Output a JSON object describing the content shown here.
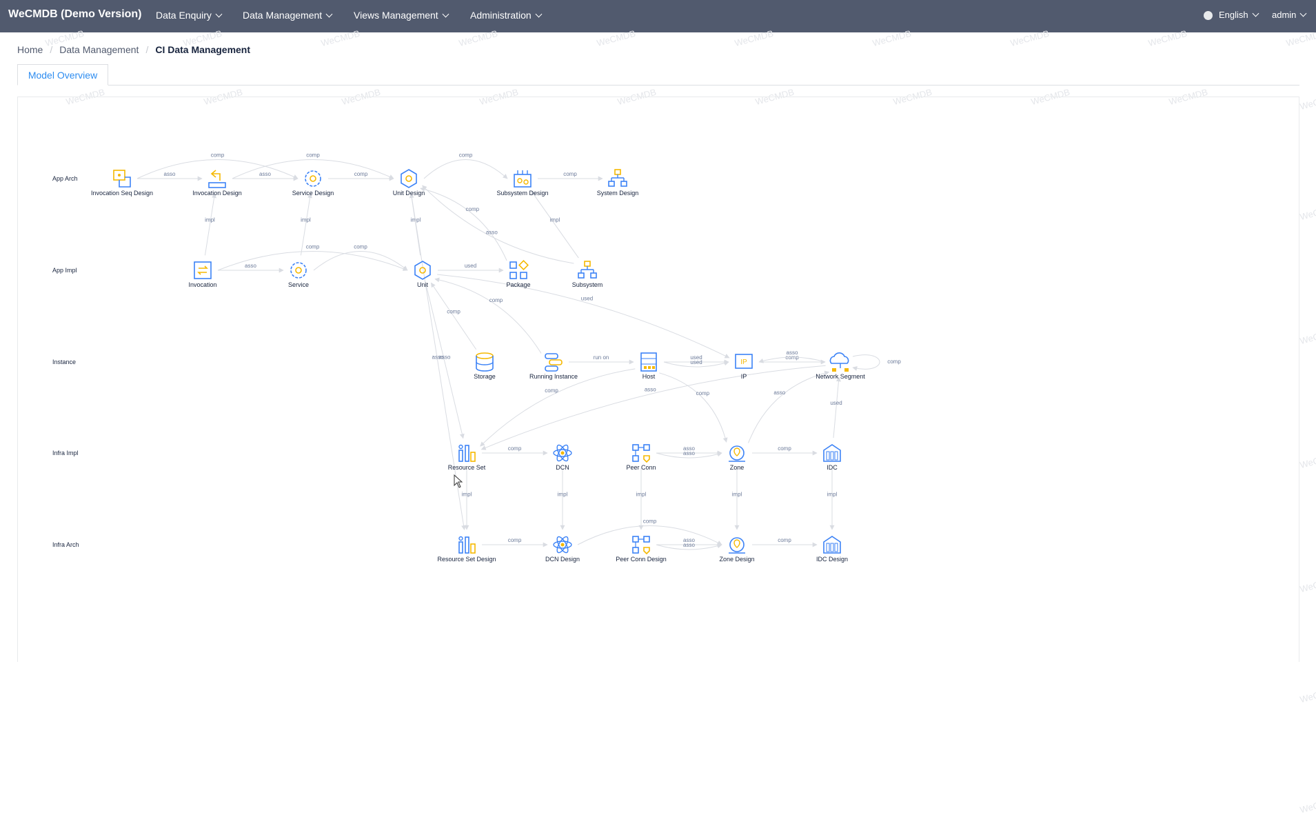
{
  "topbar": {
    "brand": "WeCMDB (Demo Version)",
    "menus": [
      "Data Enquiry",
      "Data Management",
      "Views Management",
      "Administration"
    ],
    "language": "English",
    "user": "admin"
  },
  "watermark": "WeCMDB",
  "breadcrumb": [
    "Home",
    "Data Management",
    "CI Data Management"
  ],
  "tabs": [
    "Model Overview"
  ],
  "graph": {
    "rows": [
      "App Arch",
      "App Impl",
      "Instance",
      "Infra Impl",
      "Infra Arch"
    ],
    "nodes": [
      {
        "id": "invseqd",
        "label": "Invocation Seq Design",
        "icon": "invocation-seq-design-icon"
      },
      {
        "id": "invd",
        "label": "Invocation Design",
        "icon": "invocation-design-icon"
      },
      {
        "id": "svcd",
        "label": "Service Design",
        "icon": "service-design-icon"
      },
      {
        "id": "unitd",
        "label": "Unit Design",
        "icon": "unit-design-icon"
      },
      {
        "id": "subd",
        "label": "Subsystem Design",
        "icon": "subsystem-design-icon"
      },
      {
        "id": "sysd",
        "label": "System Design",
        "icon": "system-design-icon"
      },
      {
        "id": "inv",
        "label": "Invocation",
        "icon": "invocation-icon"
      },
      {
        "id": "svc",
        "label": "Service",
        "icon": "service-icon"
      },
      {
        "id": "unit",
        "label": "Unit",
        "icon": "unit-icon"
      },
      {
        "id": "pkg",
        "label": "Package",
        "icon": "package-icon"
      },
      {
        "id": "sub",
        "label": "Subsystem",
        "icon": "subsystem-icon"
      },
      {
        "id": "stor",
        "label": "Storage",
        "icon": "storage-icon"
      },
      {
        "id": "run",
        "label": "Running Instance",
        "icon": "running-instance-icon"
      },
      {
        "id": "host",
        "label": "Host",
        "icon": "host-icon"
      },
      {
        "id": "ip",
        "label": "IP",
        "icon": "ip-icon"
      },
      {
        "id": "netseg",
        "label": "Network Segment",
        "icon": "network-segment-icon"
      },
      {
        "id": "rs",
        "label": "Resource Set",
        "icon": "resource-set-icon"
      },
      {
        "id": "dcn",
        "label": "DCN",
        "icon": "dcn-icon"
      },
      {
        "id": "peer",
        "label": "Peer Conn",
        "icon": "peer-conn-icon"
      },
      {
        "id": "zone",
        "label": "Zone",
        "icon": "zone-icon"
      },
      {
        "id": "idc",
        "label": "IDC",
        "icon": "idc-icon"
      },
      {
        "id": "rsd",
        "label": "Resource Set Design",
        "icon": "resource-set-design-icon"
      },
      {
        "id": "dcnd",
        "label": "DCN Design",
        "icon": "dcn-design-icon"
      },
      {
        "id": "peerd",
        "label": "Peer Conn Design",
        "icon": "peer-conn-design-icon"
      },
      {
        "id": "zoned",
        "label": "Zone Design",
        "icon": "zone-design-icon"
      },
      {
        "id": "idcd",
        "label": "IDC Design",
        "icon": "idc-design-icon"
      }
    ],
    "edges": [
      {
        "from": "invseqd",
        "to": "invd",
        "label": "asso"
      },
      {
        "from": "invd",
        "to": "svcd",
        "label": "asso"
      },
      {
        "from": "svcd",
        "to": "unitd",
        "label": "comp"
      },
      {
        "from": "unitd",
        "to": "subd",
        "label": "comp"
      },
      {
        "from": "subd",
        "to": "sysd",
        "label": "comp"
      },
      {
        "from": "invseqd",
        "to": "svcd",
        "label": "comp"
      },
      {
        "from": "invd",
        "to": "unitd",
        "label": "comp"
      },
      {
        "from": "inv",
        "to": "invd",
        "label": "impl"
      },
      {
        "from": "svc",
        "to": "svcd",
        "label": "impl"
      },
      {
        "from": "inv",
        "to": "unit",
        "label": "comp"
      },
      {
        "from": "unit",
        "to": "unitd",
        "label": "impl"
      },
      {
        "from": "pkg",
        "to": "unitd",
        "label": "comp"
      },
      {
        "from": "sub",
        "to": "unitd",
        "label": "asso"
      },
      {
        "from": "sub",
        "to": "subd",
        "label": "impl"
      },
      {
        "from": "inv",
        "to": "svc",
        "label": "asso"
      },
      {
        "from": "svc",
        "to": "unit",
        "label": "comp"
      },
      {
        "from": "unit",
        "to": "pkg",
        "label": "used"
      },
      {
        "from": "stor",
        "to": "unit",
        "label": "comp"
      },
      {
        "from": "unit",
        "to": "ip",
        "label": "used"
      },
      {
        "from": "run",
        "to": "unit",
        "label": "comp"
      },
      {
        "from": "run",
        "to": "host",
        "label": "run on"
      },
      {
        "from": "host",
        "to": "ip",
        "label": "used"
      },
      {
        "from": "host",
        "to": "ip",
        "label": "used"
      },
      {
        "from": "ip",
        "to": "netseg",
        "label": "comp"
      },
      {
        "from": "netseg",
        "to": "ip",
        "label": "asso"
      },
      {
        "from": "netseg",
        "to": "netseg",
        "label": "comp"
      },
      {
        "from": "unitd",
        "to": "rsd",
        "label": "asso"
      },
      {
        "from": "unit",
        "to": "rs",
        "label": "asso"
      },
      {
        "from": "rs",
        "to": "dcn",
        "label": "comp"
      },
      {
        "from": "host",
        "to": "rs",
        "label": "comp"
      },
      {
        "from": "host",
        "to": "zone",
        "label": "comp"
      },
      {
        "from": "netseg",
        "to": "rs",
        "label": "asso"
      },
      {
        "from": "zone",
        "to": "netseg",
        "label": "asso"
      },
      {
        "from": "idc",
        "to": "netseg",
        "label": "used"
      },
      {
        "from": "peer",
        "to": "zone",
        "label": "asso"
      },
      {
        "from": "peer",
        "to": "zone",
        "label": "asso"
      },
      {
        "from": "zone",
        "to": "idc",
        "label": "comp"
      },
      {
        "from": "rs",
        "to": "rsd",
        "label": "impl"
      },
      {
        "from": "dcn",
        "to": "dcnd",
        "label": "impl"
      },
      {
        "from": "peer",
        "to": "peerd",
        "label": "impl"
      },
      {
        "from": "zone",
        "to": "zoned",
        "label": "impl"
      },
      {
        "from": "idc",
        "to": "idcd",
        "label": "impl"
      },
      {
        "from": "rsd",
        "to": "dcnd",
        "label": "comp"
      },
      {
        "from": "dcnd",
        "to": "zoned",
        "label": "comp"
      },
      {
        "from": "peerd",
        "to": "zoned",
        "label": "asso"
      },
      {
        "from": "peerd",
        "to": "zoned",
        "label": "asso"
      },
      {
        "from": "zoned",
        "to": "idcd",
        "label": "comp"
      }
    ]
  },
  "colors": {
    "topbar": "#515a6e",
    "accent": "#2d8cf0",
    "icon_blue": "#3b82f6",
    "icon_yellow": "#f5b800",
    "edge": "#d9dce2",
    "edge_label": "#6b7a99"
  }
}
